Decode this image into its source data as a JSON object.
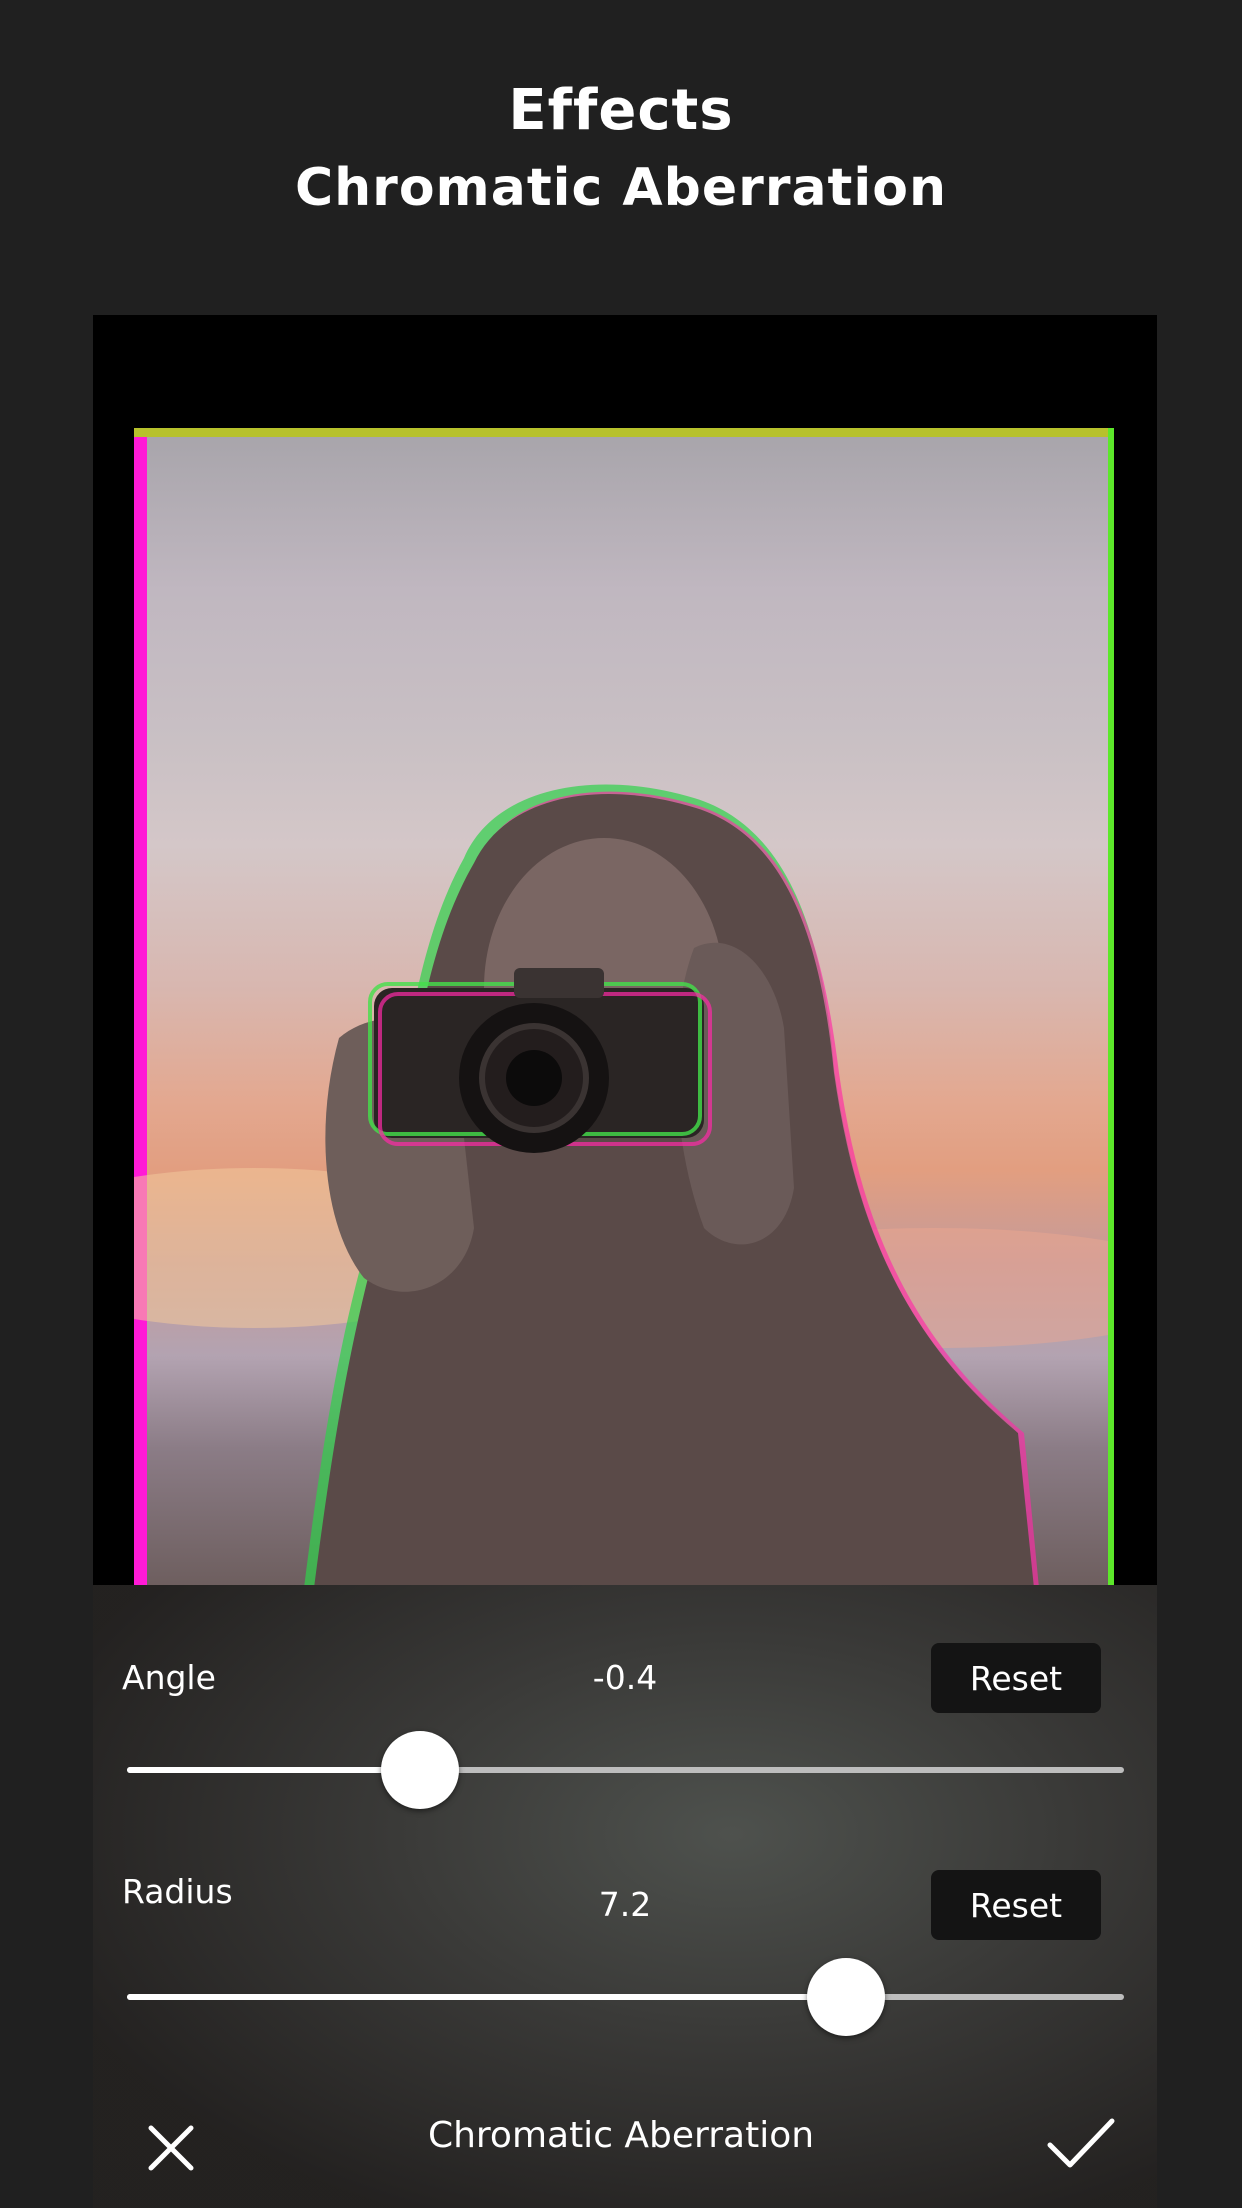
{
  "header": {
    "title": "Effects",
    "subtitle": "Chromatic Aberration"
  },
  "controls": {
    "angle": {
      "label": "Angle",
      "value": "-0.4",
      "reset_label": "Reset",
      "level": 0.294
    },
    "radius": {
      "label": "Radius",
      "value": "7.2",
      "reset_label": "Reset",
      "level": 0.721
    }
  },
  "footer": {
    "title": "Chromatic Aberration",
    "cancel_icon": "close-icon",
    "confirm_icon": "checkmark-icon"
  },
  "colors": {
    "background": "#202020",
    "fringe_magenta": "#ff1ad6",
    "fringe_green": "#5ce82a",
    "fringe_yellow": "#b7c12c"
  }
}
